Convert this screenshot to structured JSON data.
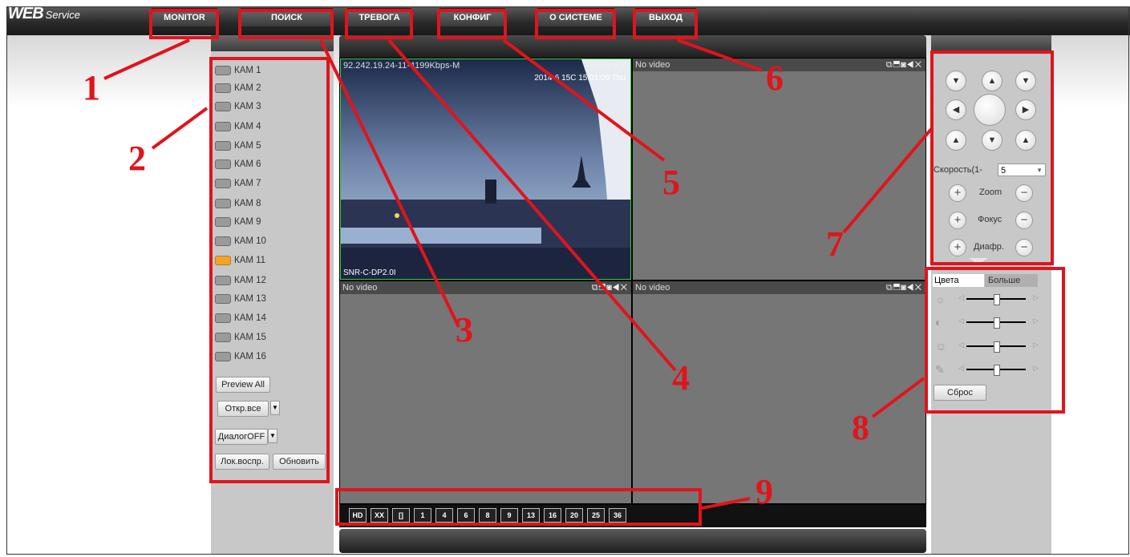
{
  "app": {
    "logo_main": "WEB",
    "logo_sub": "Service"
  },
  "nav": [
    {
      "label": "MONITOR"
    },
    {
      "label": "ПОИСК"
    },
    {
      "label": "ТРЕВОГА"
    },
    {
      "label": "КОНФИГ"
    },
    {
      "label": "О СИСТЕМЕ"
    },
    {
      "label": "ВЫХОД"
    }
  ],
  "cameras": [
    "КАМ 1",
    "КАМ 2",
    "КАМ 3",
    "КАМ 4",
    "КАМ 5",
    "КАМ 6",
    "КАМ 7",
    "КАМ 8",
    "КАМ 9",
    "КАМ 10",
    "КАМ 11",
    "КАМ 12",
    "КАМ 13",
    "КАМ 14",
    "КАМ 15",
    "КАМ 16"
  ],
  "active_camera": "КАМ 11",
  "left_buttons": {
    "preview_all": "Preview All",
    "open_all": "Откр.все",
    "dialog": "ДиалогOFF",
    "local_play": "Лок.воспр.",
    "refresh": "Обновить"
  },
  "tiles": [
    {
      "title": "92.242.19.24-11-4199Kbps-M",
      "osd_time": "2014-6 15C 15:01:09 Thu",
      "osd_name": "SNR-C-DP2.0I"
    },
    {
      "title": "No video"
    },
    {
      "title": "No video"
    },
    {
      "title": "No video"
    }
  ],
  "layout_buttons": [
    "HD",
    "XX",
    "[]",
    "1",
    "4",
    "6",
    "8",
    "9",
    "13",
    "16",
    "20",
    "25",
    "36"
  ],
  "ptz": {
    "speed_label": "Скорость(1-",
    "speed_value": "5",
    "zoom_label": "Zoom",
    "focus_label": "Фокус",
    "iris_label": "Диафр."
  },
  "color_panel": {
    "tab_colors": "Цвета",
    "tab_more": "Больше",
    "reset": "Сброс",
    "levels": [
      0.5,
      0.5,
      0.5,
      0.5
    ]
  },
  "annotations": [
    "1",
    "2",
    "3",
    "4",
    "5",
    "6",
    "7",
    "8",
    "9"
  ],
  "colors": {
    "annotation": "#e0141c",
    "active_cam": "#f2a428",
    "video_border": "#3cd23c"
  }
}
